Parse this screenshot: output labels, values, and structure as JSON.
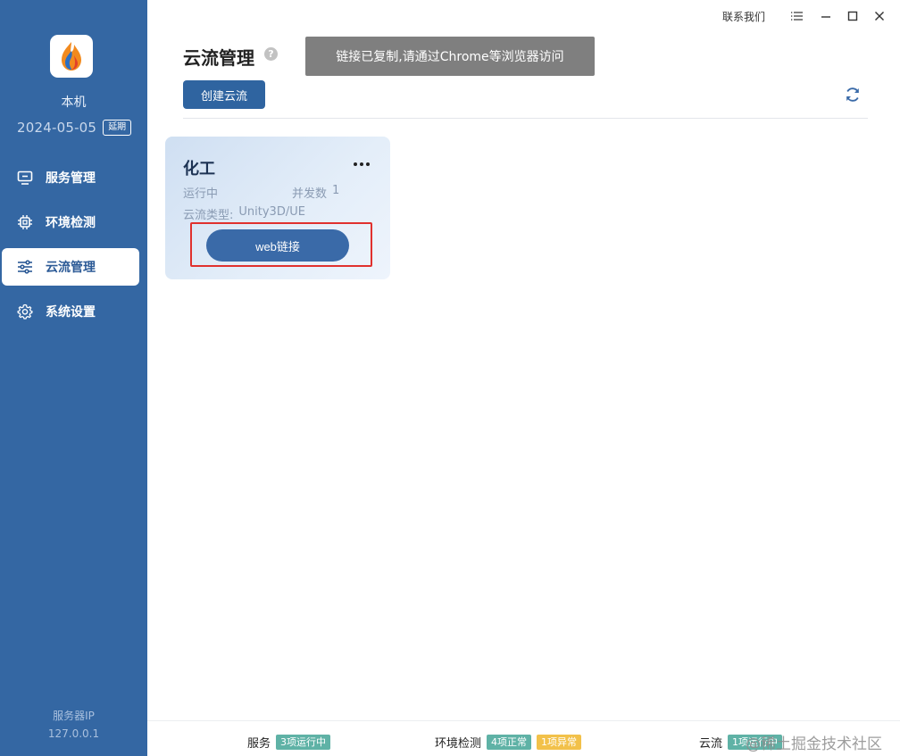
{
  "sidebar": {
    "machine_name": "本机",
    "date": "2024-05-05",
    "extend_label": "延期",
    "nav": [
      {
        "label": "服务管理",
        "icon": "monitor-icon"
      },
      {
        "label": "环境检测",
        "icon": "chip-icon"
      },
      {
        "label": "云流管理",
        "icon": "sliders-icon",
        "active": true
      },
      {
        "label": "系统设置",
        "icon": "gear-icon"
      }
    ],
    "server_ip_label": "服务器IP",
    "server_ip": "127.0.0.1"
  },
  "titlebar": {
    "contact_label": "联系我们",
    "icons": [
      "menu-icon",
      "minimize-icon",
      "maximize-icon",
      "close-icon"
    ]
  },
  "header": {
    "title": "云流管理",
    "help_icon": "?",
    "toast": "链接已复制,请通过Chrome等浏览器访问",
    "create_label": "创建云流"
  },
  "card": {
    "title": "化工",
    "status": "运行中",
    "concurrency_label": "并发数",
    "concurrency_value": "1",
    "type_label": "云流类型:",
    "type_value": "Unity3D/UE",
    "web_label": "web链接"
  },
  "statusbar": {
    "service_label": "服务",
    "service_badge": "3项运行中",
    "env_label": "环境检测",
    "env_ok_badge": "4项正常",
    "env_err_badge": "1项异常",
    "stream_label": "云流",
    "stream_badge": "1项运行中"
  },
  "watermark": "@稀土掘金技术社区",
  "colors": {
    "sidebar": "#3467a3",
    "accent": "#2f64a0",
    "badge_green": "#5fb2a6",
    "badge_yellow": "#f2c14a",
    "highlight": "#e0312e"
  }
}
